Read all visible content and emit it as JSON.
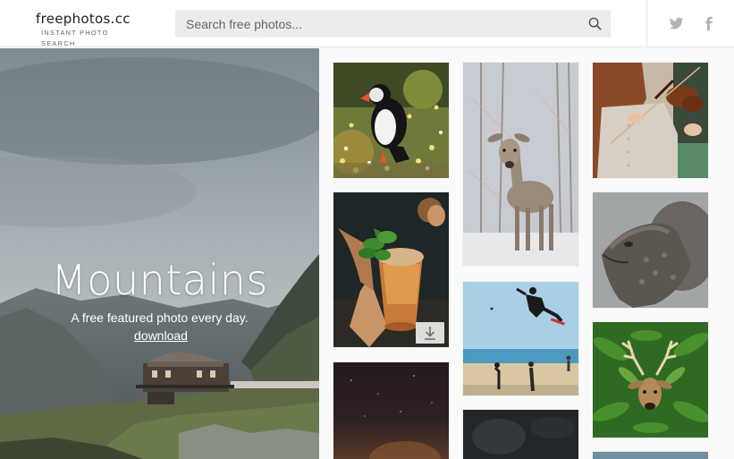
{
  "brand": {
    "name": "freephotos.cc",
    "tagline": "INSTANT PHOTO SEARCH"
  },
  "search": {
    "placeholder": "Search free photos...",
    "icon": "search-icon"
  },
  "social": [
    {
      "name": "twitter-icon"
    },
    {
      "name": "facebook-icon"
    }
  ],
  "hero": {
    "title": "Mountains",
    "subtitle": "A free featured photo every day.",
    "link": "download"
  },
  "gallery": {
    "photos": [
      {
        "subject": "puffin"
      },
      {
        "subject": "deer-in-snow"
      },
      {
        "subject": "violinist"
      },
      {
        "subject": "cocktail"
      },
      {
        "subject": "iguana"
      },
      {
        "subject": "skateboarder"
      },
      {
        "subject": "deer-in-ferns"
      },
      {
        "subject": "night-sky"
      },
      {
        "subject": "dark-cave"
      }
    ],
    "download_icon": "download-icon"
  },
  "colors": {
    "link": "#ffffff",
    "search_bg": "#ececec",
    "header_border": "#e6e6e6"
  }
}
